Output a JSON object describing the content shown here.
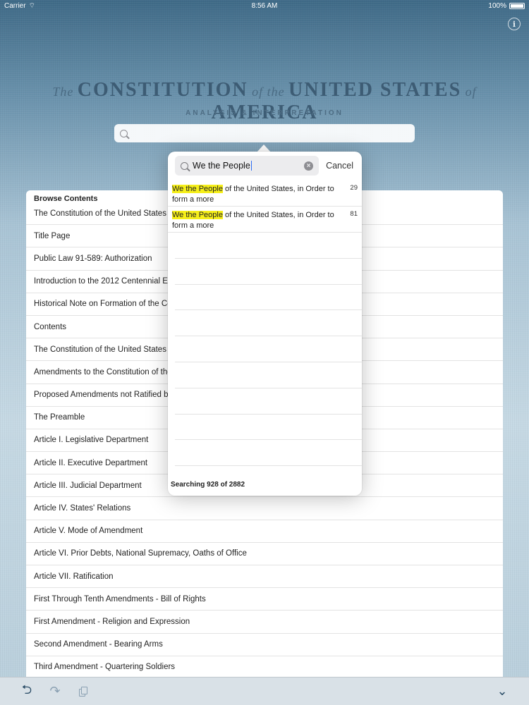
{
  "status_bar": {
    "carrier": "Carrier",
    "time": "8:56 AM",
    "battery": "100%"
  },
  "header": {
    "title_the": "The",
    "title_constitution": "CONSTITUTION",
    "title_of_the": "of the",
    "title_united_states": "UNITED STATES",
    "title_of": "of",
    "title_america": "AMERICA",
    "subtitle": "ANALYSIS & INTERPRETATION"
  },
  "main_search": {
    "placeholder": ""
  },
  "browse": {
    "header": "Browse Contents",
    "items": [
      "The Constitution of the United States of America",
      "Title Page",
      "Public Law 91-589: Authorization",
      "Introduction to the 2012 Centennial Edition",
      "Historical Note on Formation of the Constitution",
      "Contents",
      "The Constitution of the United States of America",
      "Amendments to the Constitution of the United States",
      "Proposed Amendments not Ratified by the States",
      "The Preamble",
      "Article I. Legislative Department",
      "Article II. Executive Department",
      "Article III. Judicial Department",
      "Article IV. States' Relations",
      "Article V. Mode of Amendment",
      "Article VI. Prior Debts, National Supremacy, Oaths of Office",
      "Article VII. Ratification",
      "First Through Tenth Amendments - Bill of Rights",
      "First Amendment - Religion and Expression",
      "Second Amendment - Bearing Arms",
      "Third Amendment - Quartering Soldiers"
    ]
  },
  "popover": {
    "search_value": "We the People",
    "cancel_label": "Cancel",
    "results": [
      {
        "highlight": "We the People",
        "rest": " of the United States, in Order to form a more",
        "count": "29"
      },
      {
        "highlight": "We the People",
        "rest": " of the United States, in Order to form a more",
        "count": "81"
      }
    ],
    "status": "Searching 928 of 2882"
  },
  "toolbar": {
    "undo_icon": "undo-icon",
    "redo_icon": "redo-icon",
    "copy_icon": "copy-icon",
    "chevron_icon": "chevron-down-icon"
  },
  "colors": {
    "highlight": "#f6ef1a",
    "title": "#3d5c74"
  }
}
